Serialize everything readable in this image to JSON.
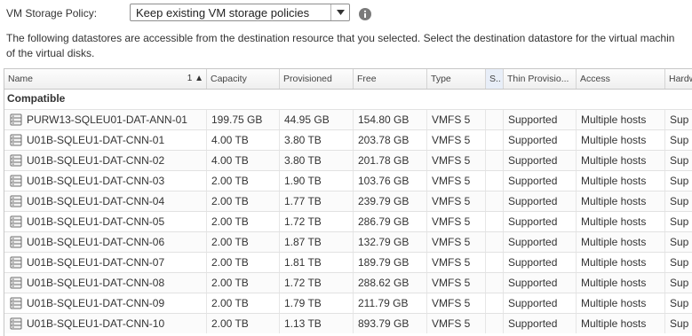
{
  "policy": {
    "label": "VM Storage Policy:",
    "selected": "Keep existing VM storage policies"
  },
  "description": {
    "line1": "The following datastores are accessible from the destination resource that you selected. Select the destination datastore for the virtual machin",
    "line2": "of the virtual disks."
  },
  "table": {
    "headers": {
      "name": "Name",
      "name_sort": "1 ▲",
      "capacity": "Capacity",
      "provisioned": "Provisioned",
      "free": "Free",
      "type": "Type",
      "s": "S..",
      "thin": "Thin Provisio...",
      "access": "Access",
      "hardware": "Hardw"
    },
    "group": "Compatible",
    "rows": [
      {
        "name": "PURW13-SQLEU01-DAT-ANN-01",
        "capacity": "199.75 GB",
        "provisioned": "44.95 GB",
        "free": "154.80 GB",
        "type": "VMFS 5",
        "thin": "Supported",
        "access": "Multiple hosts",
        "hardware": "Sup"
      },
      {
        "name": "U01B-SQLEU1-DAT-CNN-01",
        "capacity": "4.00 TB",
        "provisioned": "3.80 TB",
        "free": "203.78 GB",
        "type": "VMFS 5",
        "thin": "Supported",
        "access": "Multiple hosts",
        "hardware": "Sup"
      },
      {
        "name": "U01B-SQLEU1-DAT-CNN-02",
        "capacity": "4.00 TB",
        "provisioned": "3.80 TB",
        "free": "201.78 GB",
        "type": "VMFS 5",
        "thin": "Supported",
        "access": "Multiple hosts",
        "hardware": "Sup"
      },
      {
        "name": "U01B-SQLEU1-DAT-CNN-03",
        "capacity": "2.00 TB",
        "provisioned": "1.90 TB",
        "free": "103.76 GB",
        "type": "VMFS 5",
        "thin": "Supported",
        "access": "Multiple hosts",
        "hardware": "Sup"
      },
      {
        "name": "U01B-SQLEU1-DAT-CNN-04",
        "capacity": "2.00 TB",
        "provisioned": "1.77 TB",
        "free": "239.79 GB",
        "type": "VMFS 5",
        "thin": "Supported",
        "access": "Multiple hosts",
        "hardware": "Sup"
      },
      {
        "name": "U01B-SQLEU1-DAT-CNN-05",
        "capacity": "2.00 TB",
        "provisioned": "1.72 TB",
        "free": "286.79 GB",
        "type": "VMFS 5",
        "thin": "Supported",
        "access": "Multiple hosts",
        "hardware": "Sup"
      },
      {
        "name": "U01B-SQLEU1-DAT-CNN-06",
        "capacity": "2.00 TB",
        "provisioned": "1.87 TB",
        "free": "132.79 GB",
        "type": "VMFS 5",
        "thin": "Supported",
        "access": "Multiple hosts",
        "hardware": "Sup"
      },
      {
        "name": "U01B-SQLEU1-DAT-CNN-07",
        "capacity": "2.00 TB",
        "provisioned": "1.81 TB",
        "free": "189.79 GB",
        "type": "VMFS 5",
        "thin": "Supported",
        "access": "Multiple hosts",
        "hardware": "Sup"
      },
      {
        "name": "U01B-SQLEU1-DAT-CNN-08",
        "capacity": "2.00 TB",
        "provisioned": "1.72 TB",
        "free": "288.62 GB",
        "type": "VMFS 5",
        "thin": "Supported",
        "access": "Multiple hosts",
        "hardware": "Sup"
      },
      {
        "name": "U01B-SQLEU1-DAT-CNN-09",
        "capacity": "2.00 TB",
        "provisioned": "1.79 TB",
        "free": "211.79 GB",
        "type": "VMFS 5",
        "thin": "Supported",
        "access": "Multiple hosts",
        "hardware": "Sup"
      },
      {
        "name": "U01B-SQLEU1-DAT-CNN-10",
        "capacity": "2.00 TB",
        "provisioned": "1.13 TB",
        "free": "893.79 GB",
        "type": "VMFS 5",
        "thin": "Supported",
        "access": "Multiple hosts",
        "hardware": "Sup"
      }
    ]
  },
  "icons": {
    "dropdown": "chevron-down-icon",
    "info": "info-icon",
    "datastore": "datastore-icon"
  }
}
